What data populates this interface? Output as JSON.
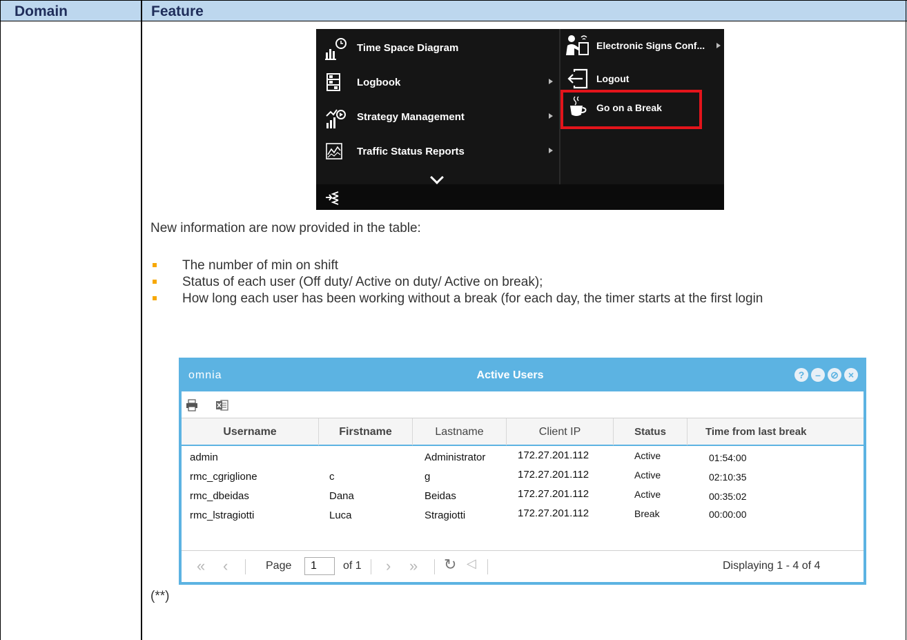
{
  "table_header": {
    "domain": "Domain",
    "feature": "Feature"
  },
  "menu": {
    "left_items": [
      {
        "label": "Time Space Diagram",
        "icon": "time-space-diagram-icon",
        "has_arrow": false
      },
      {
        "label": "Logbook",
        "icon": "logbook-icon",
        "has_arrow": true
      },
      {
        "label": "Strategy Management",
        "icon": "strategy-management-icon",
        "has_arrow": true
      },
      {
        "label": "Traffic Status Reports",
        "icon": "traffic-status-reports-icon",
        "has_arrow": true
      }
    ],
    "right_items": [
      {
        "label": "Electronic Signs Conf...",
        "icon": "electronic-signs-icon",
        "has_arrow": true
      },
      {
        "label": "Logout",
        "icon": "logout-icon",
        "has_arrow": false
      },
      {
        "label": "Go on a Break",
        "icon": "coffee-cup-icon",
        "has_arrow": false
      }
    ],
    "highlight_color": "#e3141b"
  },
  "intro_text": "New information are now provided in the table:",
  "bullets": [
    "The number of min on shift",
    "Status of each user (Off duty/ Active on duty/ Active on break);",
    "How long each user has been working without a break (for each day, the timer starts at the first login"
  ],
  "window": {
    "logo": "omnia",
    "title": "Active Users",
    "accent_color": "#5cb3e2",
    "columns": [
      "Username",
      "Firstname",
      "Lastname",
      "Client IP",
      "Status",
      "Time from last break"
    ],
    "rows": [
      {
        "username": "admin",
        "firstname": "",
        "lastname": "Administrator",
        "client_ip": "172.27.201.112",
        "status": "Active",
        "time": "01:54:00"
      },
      {
        "username": "rmc_cgriglione",
        "firstname": "c",
        "lastname": "g",
        "client_ip": "172.27.201.112",
        "status": "Active",
        "time": "02:10:35"
      },
      {
        "username": "rmc_dbeidas",
        "firstname": "Dana",
        "lastname": "Beidas",
        "client_ip": "172.27.201.112",
        "status": "Active",
        "time": "00:35:02"
      },
      {
        "username": "rmc_lstragiotti",
        "firstname": "Luca",
        "lastname": "Stragiotti",
        "client_ip": "172.27.201.112",
        "status": "Break",
        "time": "00:00:00"
      }
    ],
    "pager": {
      "page_label": "Page",
      "page_value": "1",
      "of_label": "of 1",
      "display_text": "Displaying 1 - 4 of 4"
    }
  },
  "footnote": "(**)"
}
